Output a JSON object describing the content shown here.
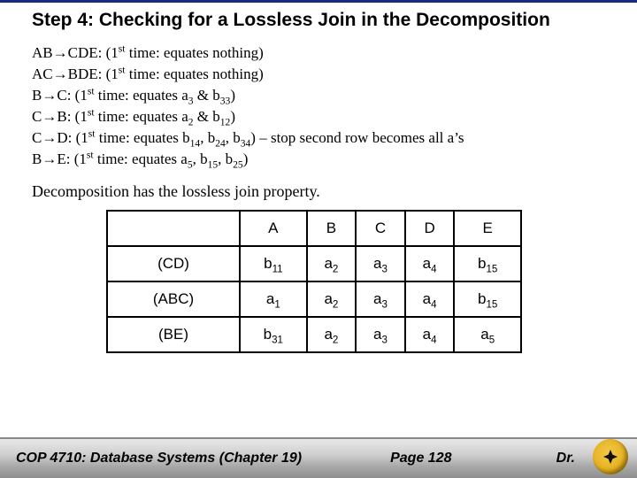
{
  "title": "Step 4: Checking for a Lossless Join in the Decomposition",
  "fds": [
    {
      "lhs": "AB",
      "rhs": "CDE",
      "note_before": "(1",
      "note_sup": "st",
      "note_after": " time: equates nothing)"
    },
    {
      "lhs": "AC",
      "rhs": "BDE",
      "note_before": "(1",
      "note_sup": "st",
      "note_after": " time: equates nothing)"
    },
    {
      "lhs": "B",
      "rhs": "C",
      "note_before": "(1",
      "note_sup": "st",
      "note_after": " time: equates a",
      "pairs": [
        [
          "3",
          ""
        ],
        [
          "33",
          ""
        ]
      ],
      "tail_literal": ")"
    },
    {
      "lhs": "C",
      "rhs": "B",
      "note_before": "(1",
      "note_sup": "st",
      "note_after": " time: equates a",
      "pairs": [
        [
          "2",
          ""
        ],
        [
          "12",
          ""
        ]
      ],
      "tail_literal": ")"
    },
    {
      "lhs": "C",
      "rhs": "D",
      "note_before": "(1",
      "note_sup": "st",
      "note_after": " time: equates b",
      "pairs": [
        [
          "14",
          ""
        ],
        [
          "24",
          ""
        ],
        [
          "34",
          ""
        ]
      ],
      "tail_literal": ") – stop second row becomes all a's"
    },
    {
      "lhs": "B",
      "rhs": "E",
      "note_before": "(1",
      "note_sup": "st",
      "note_after": " time: equates a",
      "pairs": [
        [
          "5",
          ""
        ],
        [
          "15",
          ""
        ],
        [
          "25",
          ""
        ]
      ],
      "tail_literal": ")"
    }
  ],
  "property_text": "Decomposition has the lossless join property.",
  "table": {
    "headers": [
      "A",
      "B",
      "C",
      "D",
      "E"
    ],
    "rows": [
      {
        "name": "(CD)",
        "cells": [
          {
            "base": "b",
            "sub": "11"
          },
          {
            "base": "a",
            "sub": "2"
          },
          {
            "base": "a",
            "sub": "3"
          },
          {
            "base": "a",
            "sub": "4"
          },
          {
            "base": "b",
            "sub": "15"
          }
        ]
      },
      {
        "name": "(ABC)",
        "cells": [
          {
            "base": "a",
            "sub": "1"
          },
          {
            "base": "a",
            "sub": "2"
          },
          {
            "base": "a",
            "sub": "3"
          },
          {
            "base": "a",
            "sub": "4"
          },
          {
            "base": "b",
            "sub": "15"
          }
        ]
      },
      {
        "name": "(BE)",
        "cells": [
          {
            "base": "b",
            "sub": "31"
          },
          {
            "base": "a",
            "sub": "2"
          },
          {
            "base": "a",
            "sub": "3"
          },
          {
            "base": "a",
            "sub": "4"
          },
          {
            "base": "a",
            "sub": "5"
          }
        ]
      }
    ]
  },
  "footer": {
    "course": "COP 4710: Database Systems  (Chapter 19)",
    "page": "Page 128",
    "author": "Dr."
  },
  "glyphs": {
    "arrow": "→"
  }
}
